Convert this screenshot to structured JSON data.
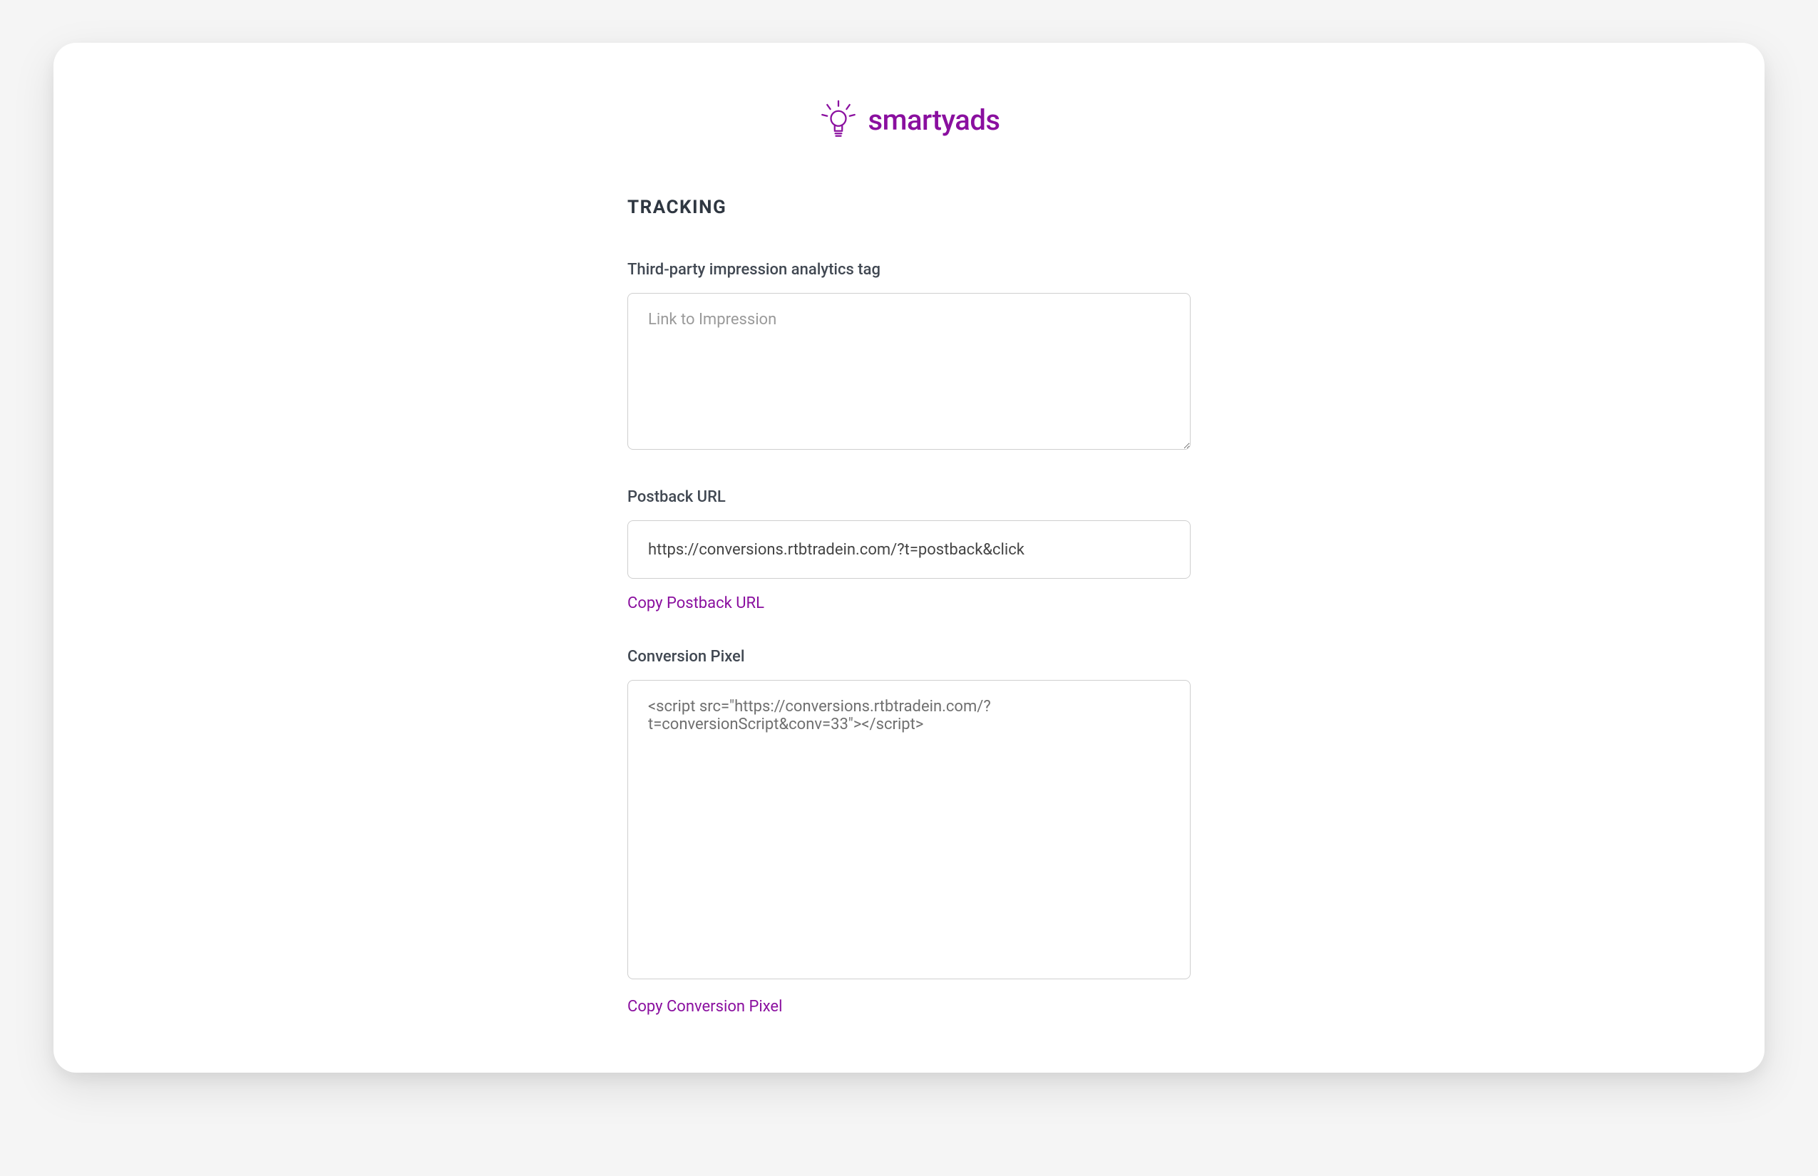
{
  "brand": {
    "name": "smartyads",
    "accent": "#8a0f9f"
  },
  "section": {
    "title": "TRACKING"
  },
  "fields": {
    "impression": {
      "label": "Third-party impression analytics tag",
      "placeholder": "Link to Impression",
      "value": ""
    },
    "postback": {
      "label": "Postback URL",
      "value": "https://conversions.rtbtradein.com/?t=postback&click",
      "copy_label": "Copy Postback URL"
    },
    "pixel": {
      "label": "Conversion Pixel",
      "value": "<script src=\"https://conversions.rtbtradein.com/?t=conversionScript&conv=33\"></script>",
      "copy_label": "Copy Conversion Pixel"
    }
  }
}
